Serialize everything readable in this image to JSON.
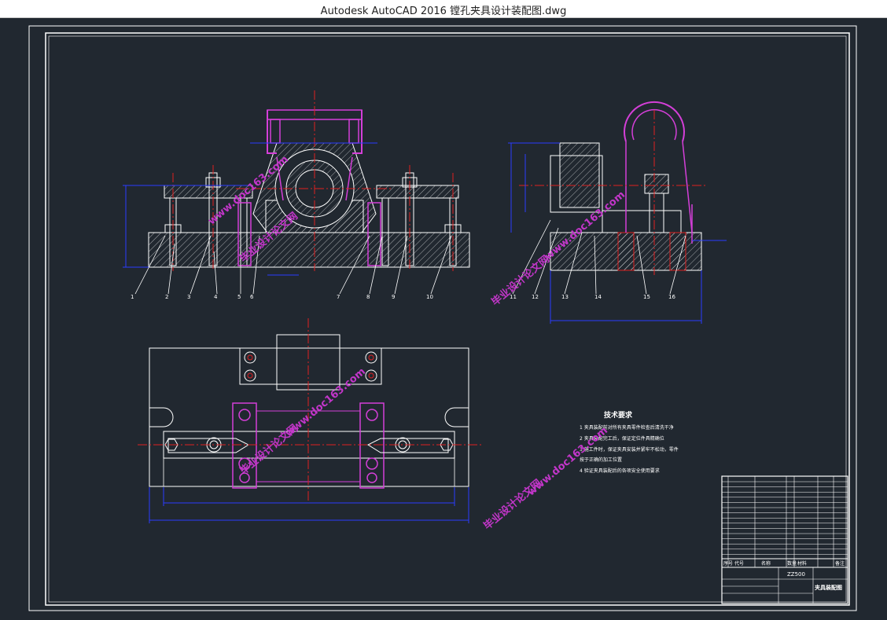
{
  "window": {
    "title": "Autodesk AutoCAD 2016     镗孔夹具设计装配图.dwg"
  },
  "drawing": {
    "tech_requirements": {
      "heading": "技术要求",
      "items": [
        "1 夹具装配前对所有夹具零件检查后清洗干净",
        "2 夹具装配完工后，保证定位件具精确位",
        "3 施工件时，保证夹具安装并紧牢不松动，零件",
        "   按于正确的加工位置",
        "4 验证夹具装配后的各项安全使用要求"
      ]
    },
    "title_block": {
      "drawing_name": "夹具装配图",
      "code": "ZZ500",
      "header_cols": [
        "序号",
        "代号",
        "名称",
        "数量",
        "材料",
        "备注"
      ]
    },
    "balloons_front": [
      "1",
      "2",
      "3",
      "4",
      "5",
      "6",
      "7",
      "8",
      "9",
      "10"
    ],
    "balloons_side": [
      "11",
      "12",
      "13",
      "14",
      "15",
      "16"
    ],
    "watermarks": [
      "www.doc163.com",
      "毕业设计论文网",
      "www.doc163.com",
      "毕业设计论文网",
      "www.doc163.com",
      "毕业设计论文网",
      "www.doc163.com",
      "毕业设计论文网"
    ]
  },
  "colors": {
    "background": "#212830",
    "line": "#ffffff",
    "magenta": "#d43fd8",
    "red": "#e02020",
    "blue": "#2a3cff",
    "watermark": "#c236c9"
  }
}
